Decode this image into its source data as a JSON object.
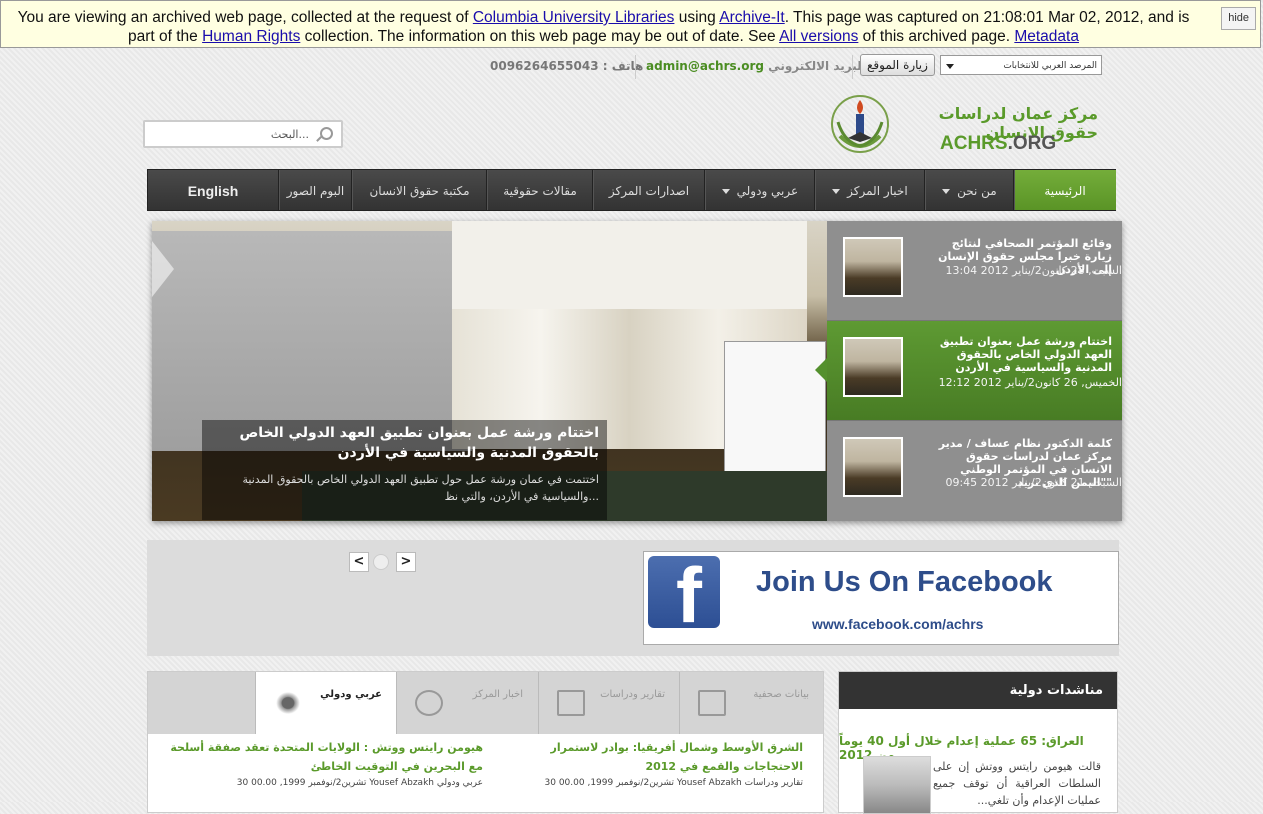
{
  "archive_banner": {
    "text_1": "You are viewing an archived web page, collected at the request of ",
    "link_columbia": "Columbia University Libraries",
    "text_2": " using ",
    "link_archiveit": "Archive-It",
    "text_3": ". This page was captured on 21:08:01 Mar 02, 2012, and is part of the ",
    "link_human_rights": "Human Rights",
    "text_4": " collection. The information on this web page may be out of date. See ",
    "link_all_versions": "All versions",
    "text_5": " of this archived page. ",
    "link_metadata": "Metadata",
    "hide_label": "hide"
  },
  "topbar": {
    "phone": "هاتف : 0096264655043",
    "email_label": "البريد الالكتروني:",
    "email_value": "admin@achrs.org",
    "visit_button": "زيارة الموقع",
    "select_value": "المرصد العربي للانتخابات"
  },
  "search": {
    "placeholder": "البحث..."
  },
  "logo": {
    "arabic_name": "مركز عمان لدراسات حقوق الانسان",
    "english_name": "ACHRS",
    "english_suffix": ".ORG"
  },
  "nav": {
    "items": [
      {
        "label": "الرئيسية"
      },
      {
        "label": "من نحن"
      },
      {
        "label": "اخبار المركز"
      },
      {
        "label": "عربي ودولي"
      },
      {
        "label": "اصدارات المركز"
      },
      {
        "label": "مقالات حقوقية"
      },
      {
        "label": "مكتبة حقوق الانسان"
      },
      {
        "label": "البوم الصور"
      },
      {
        "label": "English"
      }
    ]
  },
  "slider": {
    "caption_title": "اختتام ورشة عمل بعنوان تطبيق العهد الدولي الخاص بالحقوق المدنية والسياسية في الأردن",
    "caption_desc": "اختتمت في عمان ورشة عمل حول تطبيق العهد الدولي الخاص بالحقوق المدنية والسياسية في الأردن، والتي نظ...",
    "items": [
      {
        "title": "وقائع المؤتمر الصحافي لنتائج زيارة خبرا مجلس حقوق الإنسان إلى الأردن",
        "date": "السبت, 28 كانون2/يناير 2012 13:04"
      },
      {
        "title": "اختتام ورشة عمل بعنوان تطبيق العهد الدولي الخاص بالحقوق المدنية والسياسية في الأردن",
        "date": "الخميس, 26 كانون2/يناير 2012 12:12"
      },
      {
        "title": "كلمة الدكتور نظام عساف / مدير مركز عمان لدراسات حقوق الانسان في المؤتمر الوطني \"اليمن الذي نريد\"",
        "date": "السبت, 21 كانون2/يناير 2012 09:45"
      }
    ]
  },
  "facebook": {
    "join_text": "Join Us On Facebook",
    "url_text": "www.facebook.com/achrs"
  },
  "tabs": {
    "items": [
      {
        "label": "بيانات صحفية"
      },
      {
        "label": "تقارير ودراسات"
      },
      {
        "label": "اخبار المركز"
      },
      {
        "label": "عربي ودولي"
      }
    ],
    "news": [
      {
        "title": "الشرق الأوسط وشمال أفريقيا: بوادر لاستمرار الاحتجاجات والقمع في 2012",
        "meta": "30 تشرين2/نوفمبر 1999, 00.00 Yousef Abzakh تقارير ودراسات"
      },
      {
        "title": "هيومن رايتس ووتش : الولايات المتحدة تعقد صفقة أسلحة مع البحرين في التوقيت الخاطئ",
        "meta": "30 تشرين2/نوفمبر 1999, 00.00 Yousef Abzakh عربي ودولي"
      }
    ]
  },
  "sidebar": {
    "header": "مناشدات دولية",
    "headline": "العراق: 65 عملية إعدام خلال أول 40 يوماً من 2012",
    "excerpt": "قالت هيومن رايتس ووتش إن على السلطات العراقية أن توقف جميع عمليات الإعدام وأن تلغي..."
  }
}
